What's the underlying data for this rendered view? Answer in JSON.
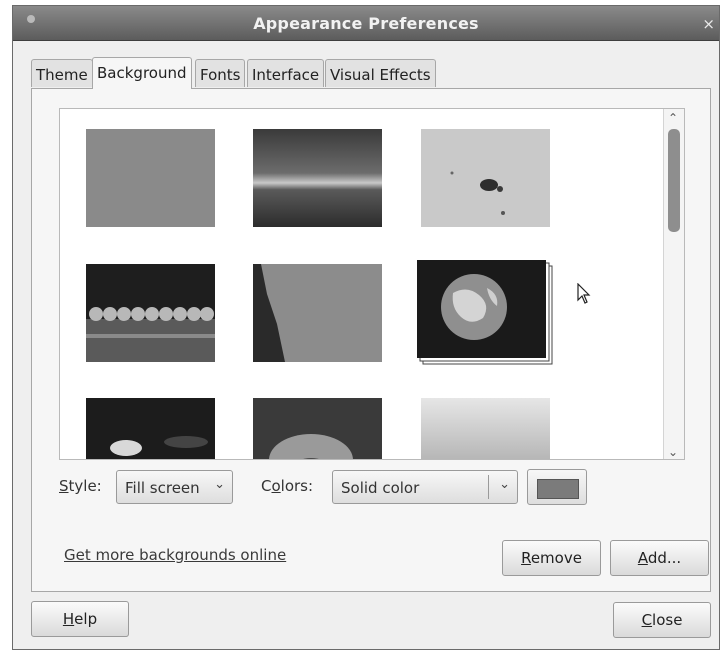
{
  "window": {
    "title": "Appearance Preferences",
    "close_glyph": "×"
  },
  "tabs": [
    {
      "label": "Theme"
    },
    {
      "label": "Background"
    },
    {
      "label": "Fonts"
    },
    {
      "label": "Interface"
    },
    {
      "label": "Visual Effects"
    }
  ],
  "active_tab": "Background",
  "controls": {
    "style_label_u": "S",
    "style_label_rest": "tyle:",
    "style_value": "Fill screen",
    "colors_label_a": "C",
    "colors_label_u": "o",
    "colors_label_rest": "lors:",
    "colors_value": "Solid color",
    "color_swatch": "#7b7b7b"
  },
  "link": {
    "text": "Get more backgrounds online"
  },
  "buttons": {
    "remove_u": "R",
    "remove_rest": "emove",
    "add_u": "A",
    "add_rest": "dd...",
    "help_u": "H",
    "help_rest": "elp",
    "close_u": "C",
    "close_rest": "lose"
  },
  "icons": {
    "dropdown": "⌄",
    "scroll_up": "⌃",
    "scroll_down": "⌄"
  }
}
